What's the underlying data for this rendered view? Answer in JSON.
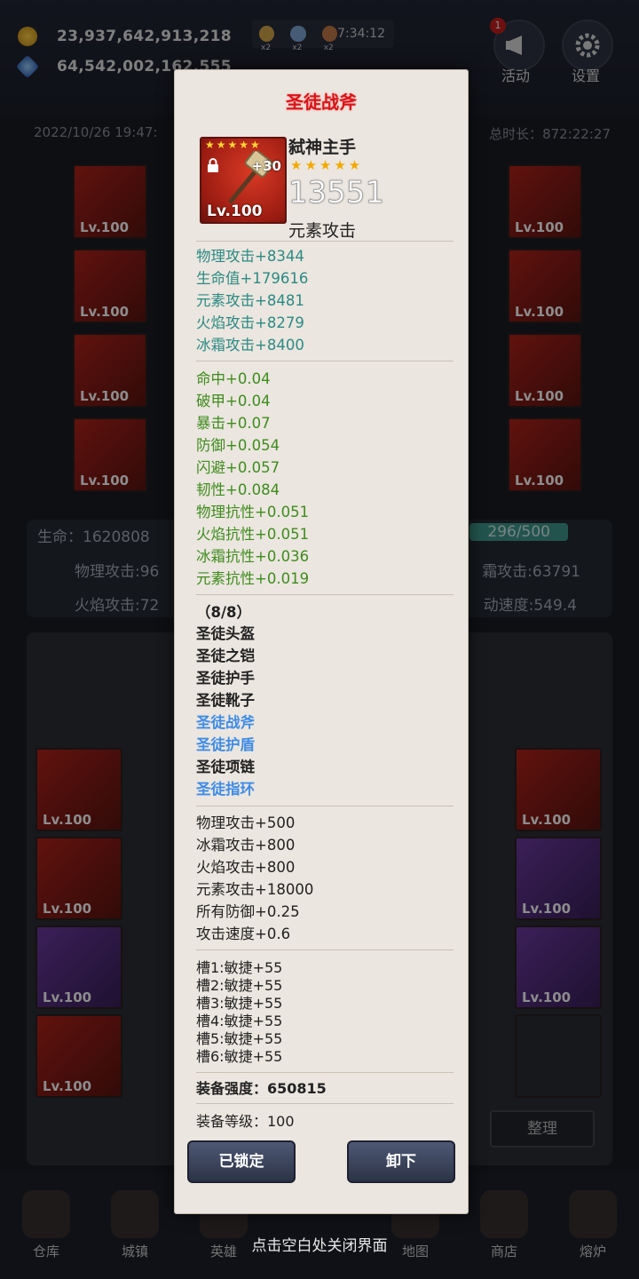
{
  "topbar": {
    "gold": "23,937,642,913,218",
    "gems": "64,542,002,162,555",
    "buff_multipliers": [
      "x2",
      "x2",
      "x2"
    ],
    "clock": "7:34:12",
    "activity_label": "活动",
    "activity_badge": "1",
    "settings_label": "设置"
  },
  "background": {
    "date": "2022/10/26 19:47:",
    "total_time": "总时长：872:22:27",
    "slots_left_lv": [
      "Lv.100",
      "Lv.100",
      "Lv.100",
      "Lv.100"
    ],
    "slots_right_lv": [
      "Lv.100",
      "Lv.100",
      "Lv.100",
      "Lv.100"
    ],
    "slot_plus": "+30",
    "hp": "生命：1620808",
    "phys_atk": "物理攻击:96",
    "frost_atk": "霜攻击:63791",
    "fire_atk": "火焰攻击:72",
    "speed": "动速度:549.4",
    "exp": "296/500",
    "sort_button": "整理",
    "bag_lv": "Lv.100"
  },
  "nav": [
    "仓库",
    "城镇",
    "英雄",
    "地图",
    "商店",
    "熔炉"
  ],
  "popup": {
    "title": "圣徒战斧",
    "item_name": "弑神主手",
    "item_stars": "★★★★★",
    "icon_stars": "★★★★★",
    "plus": "+30",
    "level": "Lv.100",
    "power": "13551",
    "type": "元素攻击",
    "main_stats": [
      "物理攻击+8344",
      "生命值+179616",
      "元素攻击+8481",
      "火焰攻击+8279",
      "冰霜攻击+8400"
    ],
    "sub_stats": [
      "命中+0.04",
      "破甲+0.04",
      "暴击+0.07",
      "防御+0.054",
      "闪避+0.057",
      "韧性+0.084",
      "物理抗性+0.051",
      "火焰抗性+0.051",
      "冰霜抗性+0.036",
      "元素抗性+0.019"
    ],
    "set_count": "（8/8）",
    "set_items": [
      {
        "name": "圣徒头盔",
        "color": "dark"
      },
      {
        "name": "圣徒之铠",
        "color": "dark"
      },
      {
        "name": "圣徒护手",
        "color": "dark"
      },
      {
        "name": "圣徒靴子",
        "color": "dark"
      },
      {
        "name": "圣徒战斧",
        "color": "blue"
      },
      {
        "name": "圣徒护盾",
        "color": "blue"
      },
      {
        "name": "圣徒项链",
        "color": "dark"
      },
      {
        "name": "圣徒指环",
        "color": "blue"
      }
    ],
    "set_bonus": [
      "物理攻击+500",
      "冰霜攻击+800",
      "火焰攻击+800",
      "元素攻击+18000",
      "所有防御+0.25",
      "攻击速度+0.6"
    ],
    "sockets": [
      "槽1:敏捷+55",
      "槽2:敏捷+55",
      "槽3:敏捷+55",
      "槽4:敏捷+55",
      "槽5:敏捷+55",
      "槽6:敏捷+55"
    ],
    "strength": "装备强度：650815",
    "equip_level": "装备等级：100",
    "lock_button": "已锁定",
    "unequip_button": "卸下"
  },
  "close_hint": "点击空白处关闭界面"
}
